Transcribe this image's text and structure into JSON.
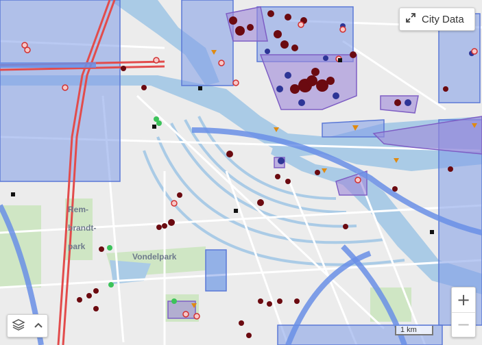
{
  "map": {
    "place_labels": [
      {
        "id": "rembrandt-1",
        "text": "Rem-"
      },
      {
        "id": "rembrandt-2",
        "text": "brandt-"
      },
      {
        "id": "rembrandt-3",
        "text": "park"
      },
      {
        "id": "vondelpark",
        "text": "Vondelpark"
      }
    ],
    "colors": {
      "water": "#aacbe6",
      "overlay_blue": "#7f9de8",
      "overlay_purple": "#9f89d8",
      "highway": "#e24c4c",
      "poi_dark_red": "#6b0a10",
      "poi_navy": "#2d3596",
      "poi_green": "#3cc35a",
      "poi_orange": "#e08a10"
    }
  },
  "controls": {
    "city_data_label": "City Data",
    "expand_icon": "expand-arrows-icon",
    "layers_icon": "layers-icon",
    "chevron_icon": "chevron-up-icon",
    "zoom_in": "+",
    "zoom_out": "−"
  },
  "scale_bar": {
    "label": "1 km"
  }
}
